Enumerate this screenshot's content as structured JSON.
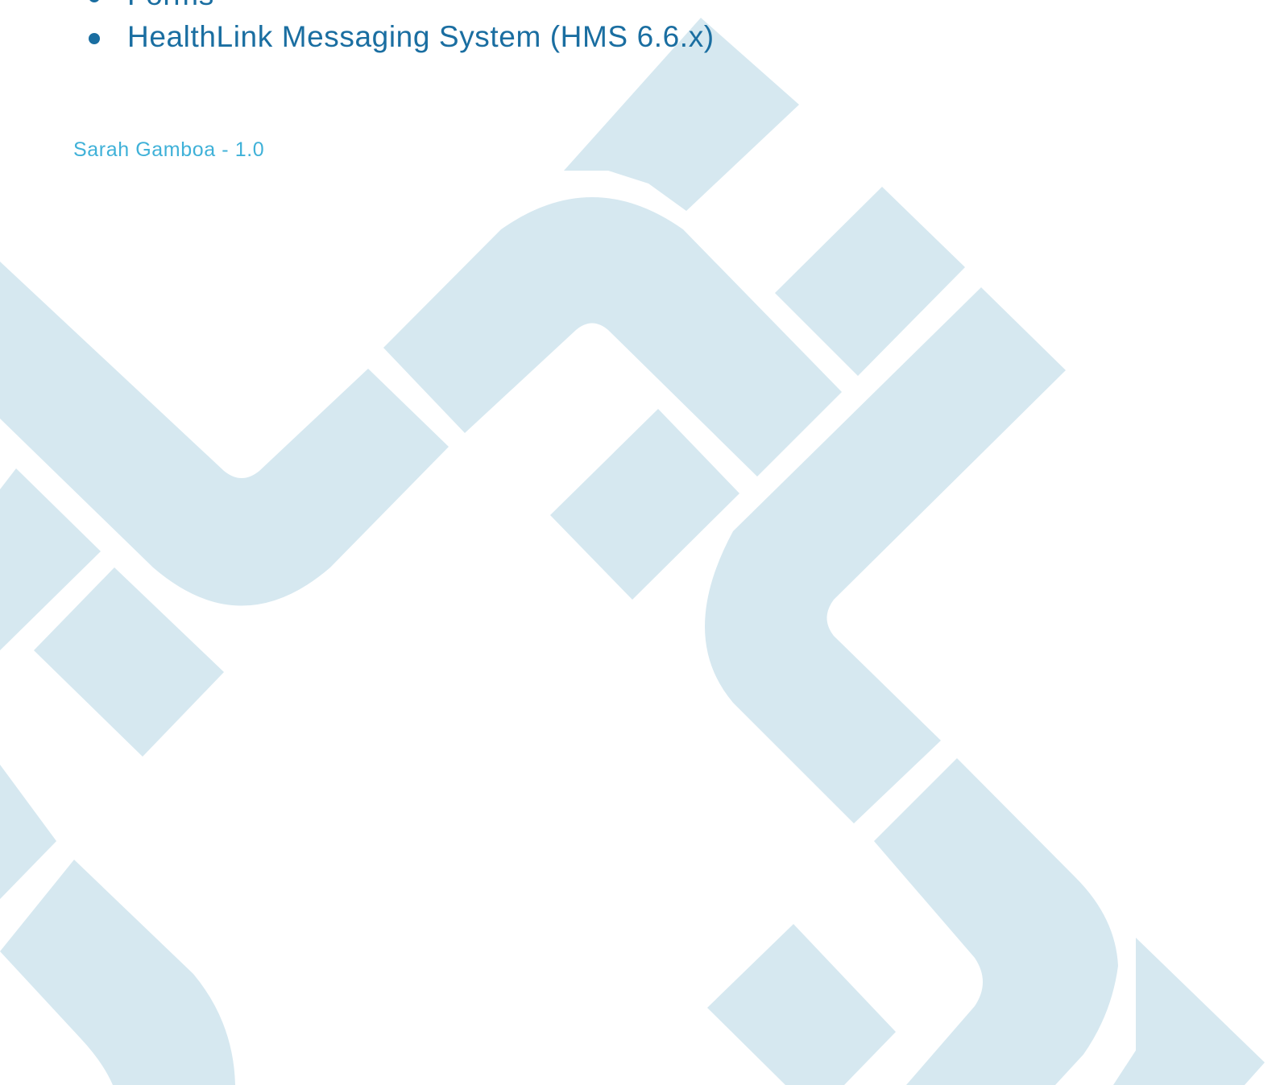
{
  "colors": {
    "text_blue": "#1a6ea1",
    "author_blue": "#3fb1d8",
    "watermark_blue": "#d6e8f0",
    "background": "#ffffff"
  },
  "bullet_list": {
    "items": [
      {
        "label": "Forms"
      },
      {
        "label": "HealthLink Messaging System (HMS 6.6.x)"
      }
    ]
  },
  "footer": {
    "author_version": "Sarah Gamboa - 1.0"
  },
  "watermark": {
    "icon": "healthlink-chain-pattern"
  }
}
